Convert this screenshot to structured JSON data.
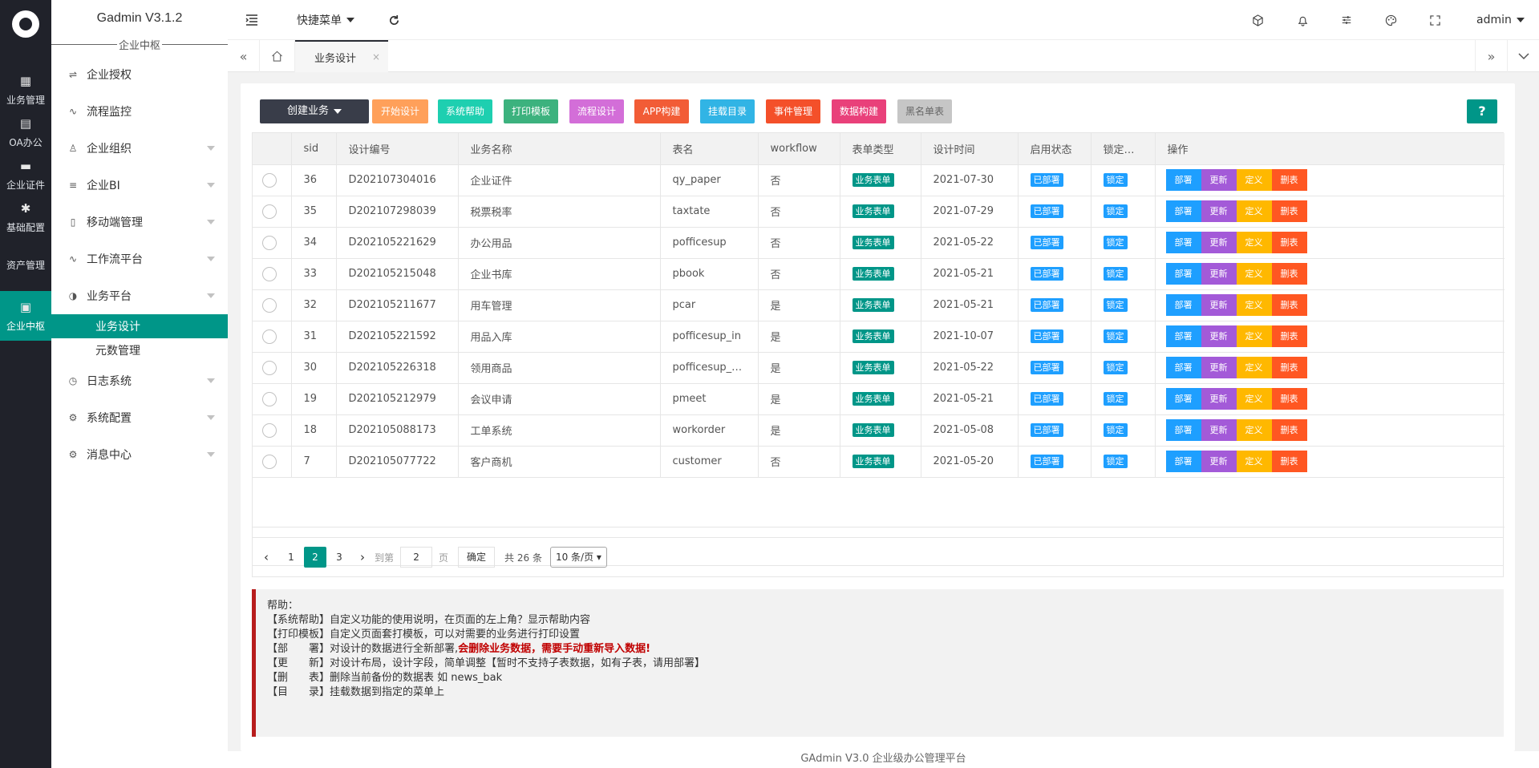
{
  "rail": {
    "items": [
      {
        "icon": "table-icon",
        "glyph": "▦",
        "label": "业务管理"
      },
      {
        "icon": "office-icon",
        "glyph": "▤",
        "label": "OA办公"
      },
      {
        "icon": "certificate-icon",
        "glyph": "▬",
        "label": "企业证件"
      },
      {
        "icon": "settings-icon",
        "glyph": "✱",
        "label": "基础配置"
      },
      {
        "icon": "",
        "glyph": "",
        "label": "资产管理"
      },
      {
        "icon": "apps-icon",
        "glyph": "▣",
        "label": "企业中枢"
      }
    ]
  },
  "menu": {
    "brand": "Gadmin V3.1.2",
    "section": "企业中枢",
    "items": [
      {
        "icon": "sliders-icon",
        "glyph": "⇌",
        "label": "企业授权"
      },
      {
        "icon": "pulse-icon",
        "glyph": "∿",
        "label": "流程监控"
      },
      {
        "icon": "user-icon",
        "glyph": "♙",
        "label": "企业组织"
      },
      {
        "icon": "align-icon",
        "glyph": "≡",
        "label": "企业BI"
      },
      {
        "icon": "mobile-icon",
        "glyph": "▯",
        "label": "移动端管理"
      },
      {
        "icon": "pulse-icon",
        "glyph": "∿",
        "label": "工作流平台"
      },
      {
        "icon": "compass-icon",
        "glyph": "◑",
        "label": "业务平台"
      },
      {
        "label": "业务设计"
      },
      {
        "label": "元数管理"
      },
      {
        "icon": "clock-icon",
        "glyph": "◷",
        "label": "日志系统"
      },
      {
        "icon": "gear-icon",
        "glyph": "⚙",
        "label": "系统配置"
      },
      {
        "icon": "gear-icon",
        "glyph": "⚙",
        "label": "消息中心"
      }
    ]
  },
  "header": {
    "quick_menu": "快捷菜单",
    "user": "admin"
  },
  "tabs": {
    "active": "业务设计",
    "close": "×"
  },
  "toolbar": {
    "create": "创建业务",
    "buttons": [
      {
        "label": "开始设计",
        "color": "#ffa05a"
      },
      {
        "label": "系统帮助",
        "color": "#1ecfb0"
      },
      {
        "label": "打印模板",
        "color": "#3cb27e"
      },
      {
        "label": "流程设计",
        "color": "#d36ed8"
      },
      {
        "label": "APP构建",
        "color": "#f25c36"
      },
      {
        "label": "挂载目录",
        "color": "#31b4e5"
      },
      {
        "label": "事件管理",
        "color": "#f4502a"
      },
      {
        "label": "数据构建",
        "color": "#e9407a"
      },
      {
        "label": "黑名单表",
        "color": "#c6c6c6"
      }
    ],
    "help": "?"
  },
  "table": {
    "headers": [
      "sid",
      "设计编号",
      "业务名称",
      "表名",
      "workflow",
      "表单类型",
      "设计时间",
      "启用状态",
      "锁定…",
      "操作"
    ],
    "rows": [
      {
        "sid": "36",
        "code": "D202107304016",
        "name": "企业证件",
        "table": "qy_paper",
        "workflow": "否",
        "type": "业务表单",
        "time": "2021-07-30",
        "status": "已部署",
        "lock": "锁定"
      },
      {
        "sid": "35",
        "code": "D202107298039",
        "name": "税票税率",
        "table": "taxtate",
        "workflow": "否",
        "type": "业务表单",
        "time": "2021-07-29",
        "status": "已部署",
        "lock": "锁定"
      },
      {
        "sid": "34",
        "code": "D202105221629",
        "name": "办公用品",
        "table": "pofficesup",
        "workflow": "否",
        "type": "业务表单",
        "time": "2021-05-22",
        "status": "已部署",
        "lock": "锁定"
      },
      {
        "sid": "33",
        "code": "D202105215048",
        "name": "企业书库",
        "table": "pbook",
        "workflow": "否",
        "type": "业务表单",
        "time": "2021-05-21",
        "status": "已部署",
        "lock": "锁定"
      },
      {
        "sid": "32",
        "code": "D202105211677",
        "name": "用车管理",
        "table": "pcar",
        "workflow": "是",
        "type": "业务表单",
        "time": "2021-05-21",
        "status": "已部署",
        "lock": "锁定"
      },
      {
        "sid": "31",
        "code": "D202105221592",
        "name": "用品入库",
        "table": "pofficesup_in",
        "workflow": "是",
        "type": "业务表单",
        "time": "2021-10-07",
        "status": "已部署",
        "lock": "锁定"
      },
      {
        "sid": "30",
        "code": "D202105226318",
        "name": "领用商品",
        "table": "pofficesup_…",
        "workflow": "是",
        "type": "业务表单",
        "time": "2021-05-22",
        "status": "已部署",
        "lock": "锁定"
      },
      {
        "sid": "19",
        "code": "D202105212979",
        "name": "会议申请",
        "table": "pmeet",
        "workflow": "是",
        "type": "业务表单",
        "time": "2021-05-21",
        "status": "已部署",
        "lock": "锁定"
      },
      {
        "sid": "18",
        "code": "D202105088173",
        "name": "工单系统",
        "table": "workorder",
        "workflow": "是",
        "type": "业务表单",
        "time": "2021-05-08",
        "status": "已部署",
        "lock": "锁定"
      },
      {
        "sid": "7",
        "code": "D202105077722",
        "name": "客户商机",
        "table": "customer",
        "workflow": "否",
        "type": "业务表单",
        "time": "2021-05-20",
        "status": "已部署",
        "lock": "锁定"
      }
    ],
    "ops": [
      {
        "label": "部署",
        "color": "#1e9fff"
      },
      {
        "label": "更新",
        "color": "#a35ad8"
      },
      {
        "label": "定义",
        "color": "#ffb800"
      },
      {
        "label": "删表",
        "color": "#ff5722"
      }
    ],
    "type_color": "#009688",
    "status_color": "#1e9fff",
    "lock_color": "#1e9fff"
  },
  "pager": {
    "pages": [
      "1",
      "2",
      "3"
    ],
    "current": "2",
    "goto": "到第",
    "goto_value": "2",
    "page_unit": "页",
    "confirm": "确定",
    "total": "共 26 条",
    "page_size": "10 条/页"
  },
  "note": {
    "title": "帮助：",
    "lines": [
      {
        "text": "【系统帮助】自定义功能的使用说明，在页面的左上角？显示帮助内容"
      },
      {
        "text": "【打印模板】自定义页面套打模板，可以对需要的业务进行打印设置"
      },
      {
        "text": "【部　　署】对设计的数据进行全新部署,",
        "red": "会删除业务数据，需要手动重新导入数据!"
      },
      {
        "text": "【更　　新】对设计布局，设计字段，简单调整【暂时不支持子表数据，如有子表，请用部署】"
      },
      {
        "text": "【删　　表】删除当前备份的数据表 如 news_bak"
      },
      {
        "text": "【目　　录】挂载数据到指定的菜单上"
      }
    ]
  },
  "footer": "GAdmin V3.0 企业级办公管理平台"
}
